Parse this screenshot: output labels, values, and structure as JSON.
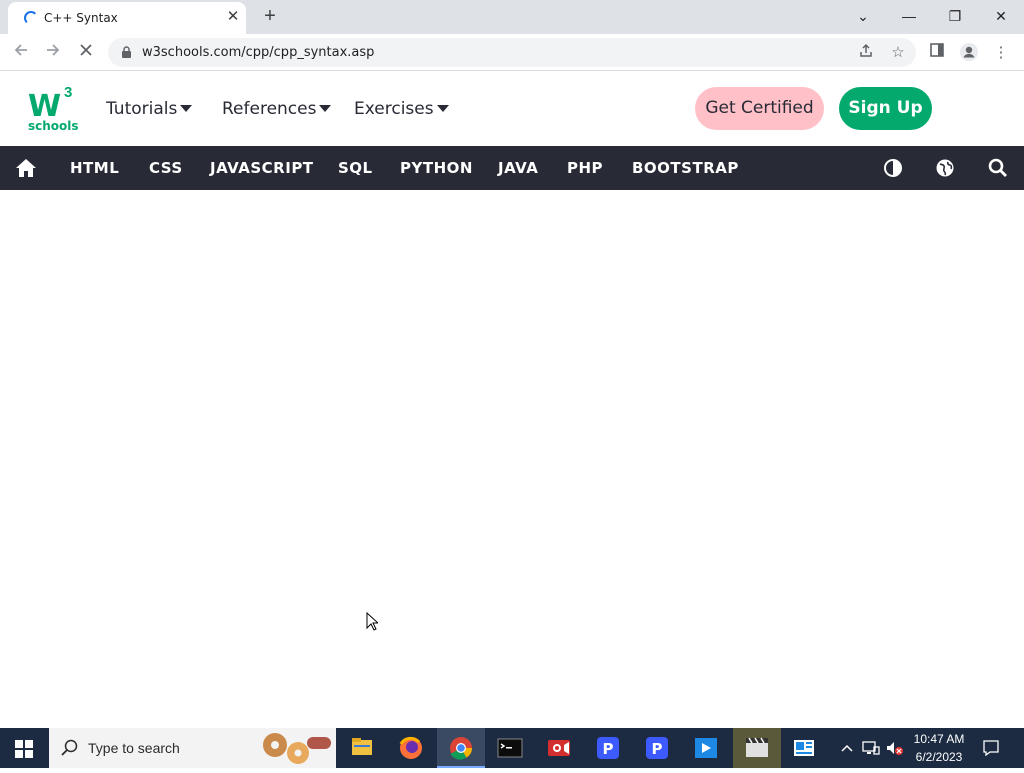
{
  "browser": {
    "tab_title": "C++ Syntax",
    "tab_close_glyph": "✕",
    "new_tab_glyph": "+",
    "url": "w3schools.com/cpp/cpp_syntax.asp",
    "window_controls": [
      "⌄",
      "—",
      "❐",
      "✕"
    ]
  },
  "site": {
    "logo_main": "W",
    "logo_sup": "3",
    "logo_sub": "schools",
    "menus": [
      "Tutorials",
      "References",
      "Exercises"
    ],
    "get_certified": "Get Certified",
    "sign_up": "Sign Up",
    "nav_links": [
      "HTML",
      "CSS",
      "JAVASCRIPT",
      "SQL",
      "PYTHON",
      "JAVA",
      "PHP",
      "BOOTSTRAP"
    ]
  },
  "taskbar": {
    "search_placeholder": "Type to search",
    "time": "10:47 AM",
    "date": "6/2/2023"
  },
  "colors": {
    "w3_green": "#04aa6d",
    "w3_dark": "#282a35",
    "cert_pink": "#ffc0c7",
    "taskbar": "#1c2b42"
  }
}
